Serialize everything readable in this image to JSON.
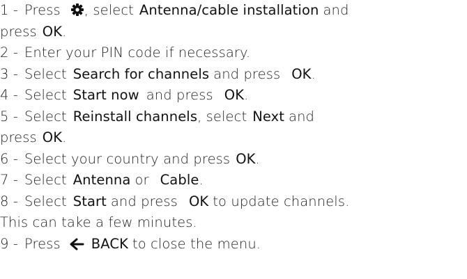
{
  "steps": [
    {
      "num": "1 -",
      "t1": "Press",
      "t2": ", select",
      "b1": "Antenna/cable installation",
      "t3": "and",
      "t4": "press",
      "b2": "OK",
      "t5": "."
    },
    {
      "num": "2 -",
      "t1": "Enter your PIN code if necessary."
    },
    {
      "num": "3 -",
      "t1": "Select",
      "b1": "Search for channels",
      "t2": "and press",
      "b2": "OK",
      "t3": "."
    },
    {
      "num": "4 -",
      "t1": "Select",
      "b1": "Start now",
      "t2": "and press",
      "b2": "OK",
      "t3": "."
    },
    {
      "num": "5 -",
      "t1": "Select",
      "b1": "Reinstall channels",
      "t2": ", select",
      "b2": "Next",
      "t3": "and",
      "t4": "press",
      "b3": "OK",
      "t5": "."
    },
    {
      "num": "6 -",
      "t1": "Select your country and press",
      "b1": "OK",
      "t2": "."
    },
    {
      "num": "7 -",
      "t1": "Select",
      "b1": "Antenna",
      "t2": "or",
      "b2": "Cable",
      "t3": "."
    },
    {
      "num": "8 -",
      "t1": "Select",
      "b1": "Start",
      "t2": "and press",
      "b2": "OK",
      "t3": "to update channels.",
      "t4": "This can take a few minutes."
    },
    {
      "num": "9 -",
      "t1": "Press",
      "b1": "BACK",
      "t2": "to close the menu."
    }
  ],
  "icons": {
    "settings": "gear-icon",
    "back": "back-arrow-icon"
  }
}
